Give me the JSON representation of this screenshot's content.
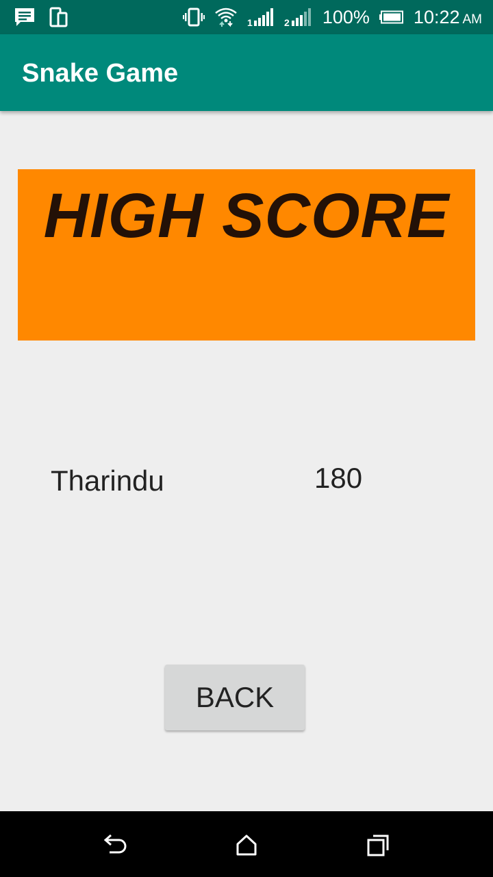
{
  "status_bar": {
    "battery_percent": "100%",
    "time": "10:22",
    "ampm": "AM",
    "icons": [
      "message-icon",
      "device-icon",
      "vibrate-icon",
      "wifi-icon",
      "signal-1-icon",
      "signal-2-icon",
      "battery-icon"
    ]
  },
  "app_bar": {
    "title": "Snake Game"
  },
  "banner": {
    "title": "HIGH SCORE",
    "color": "#ff8800"
  },
  "score": {
    "player": "Tharindu",
    "value": "180"
  },
  "actions": {
    "back_label": "BACK"
  },
  "nav_bar": {
    "icons": [
      "back-nav-icon",
      "home-icon",
      "recents-icon"
    ]
  },
  "colors": {
    "status_bar": "#00695c",
    "app_bar": "#00897b",
    "background": "#eeeeee",
    "button": "#d6d7d7"
  }
}
